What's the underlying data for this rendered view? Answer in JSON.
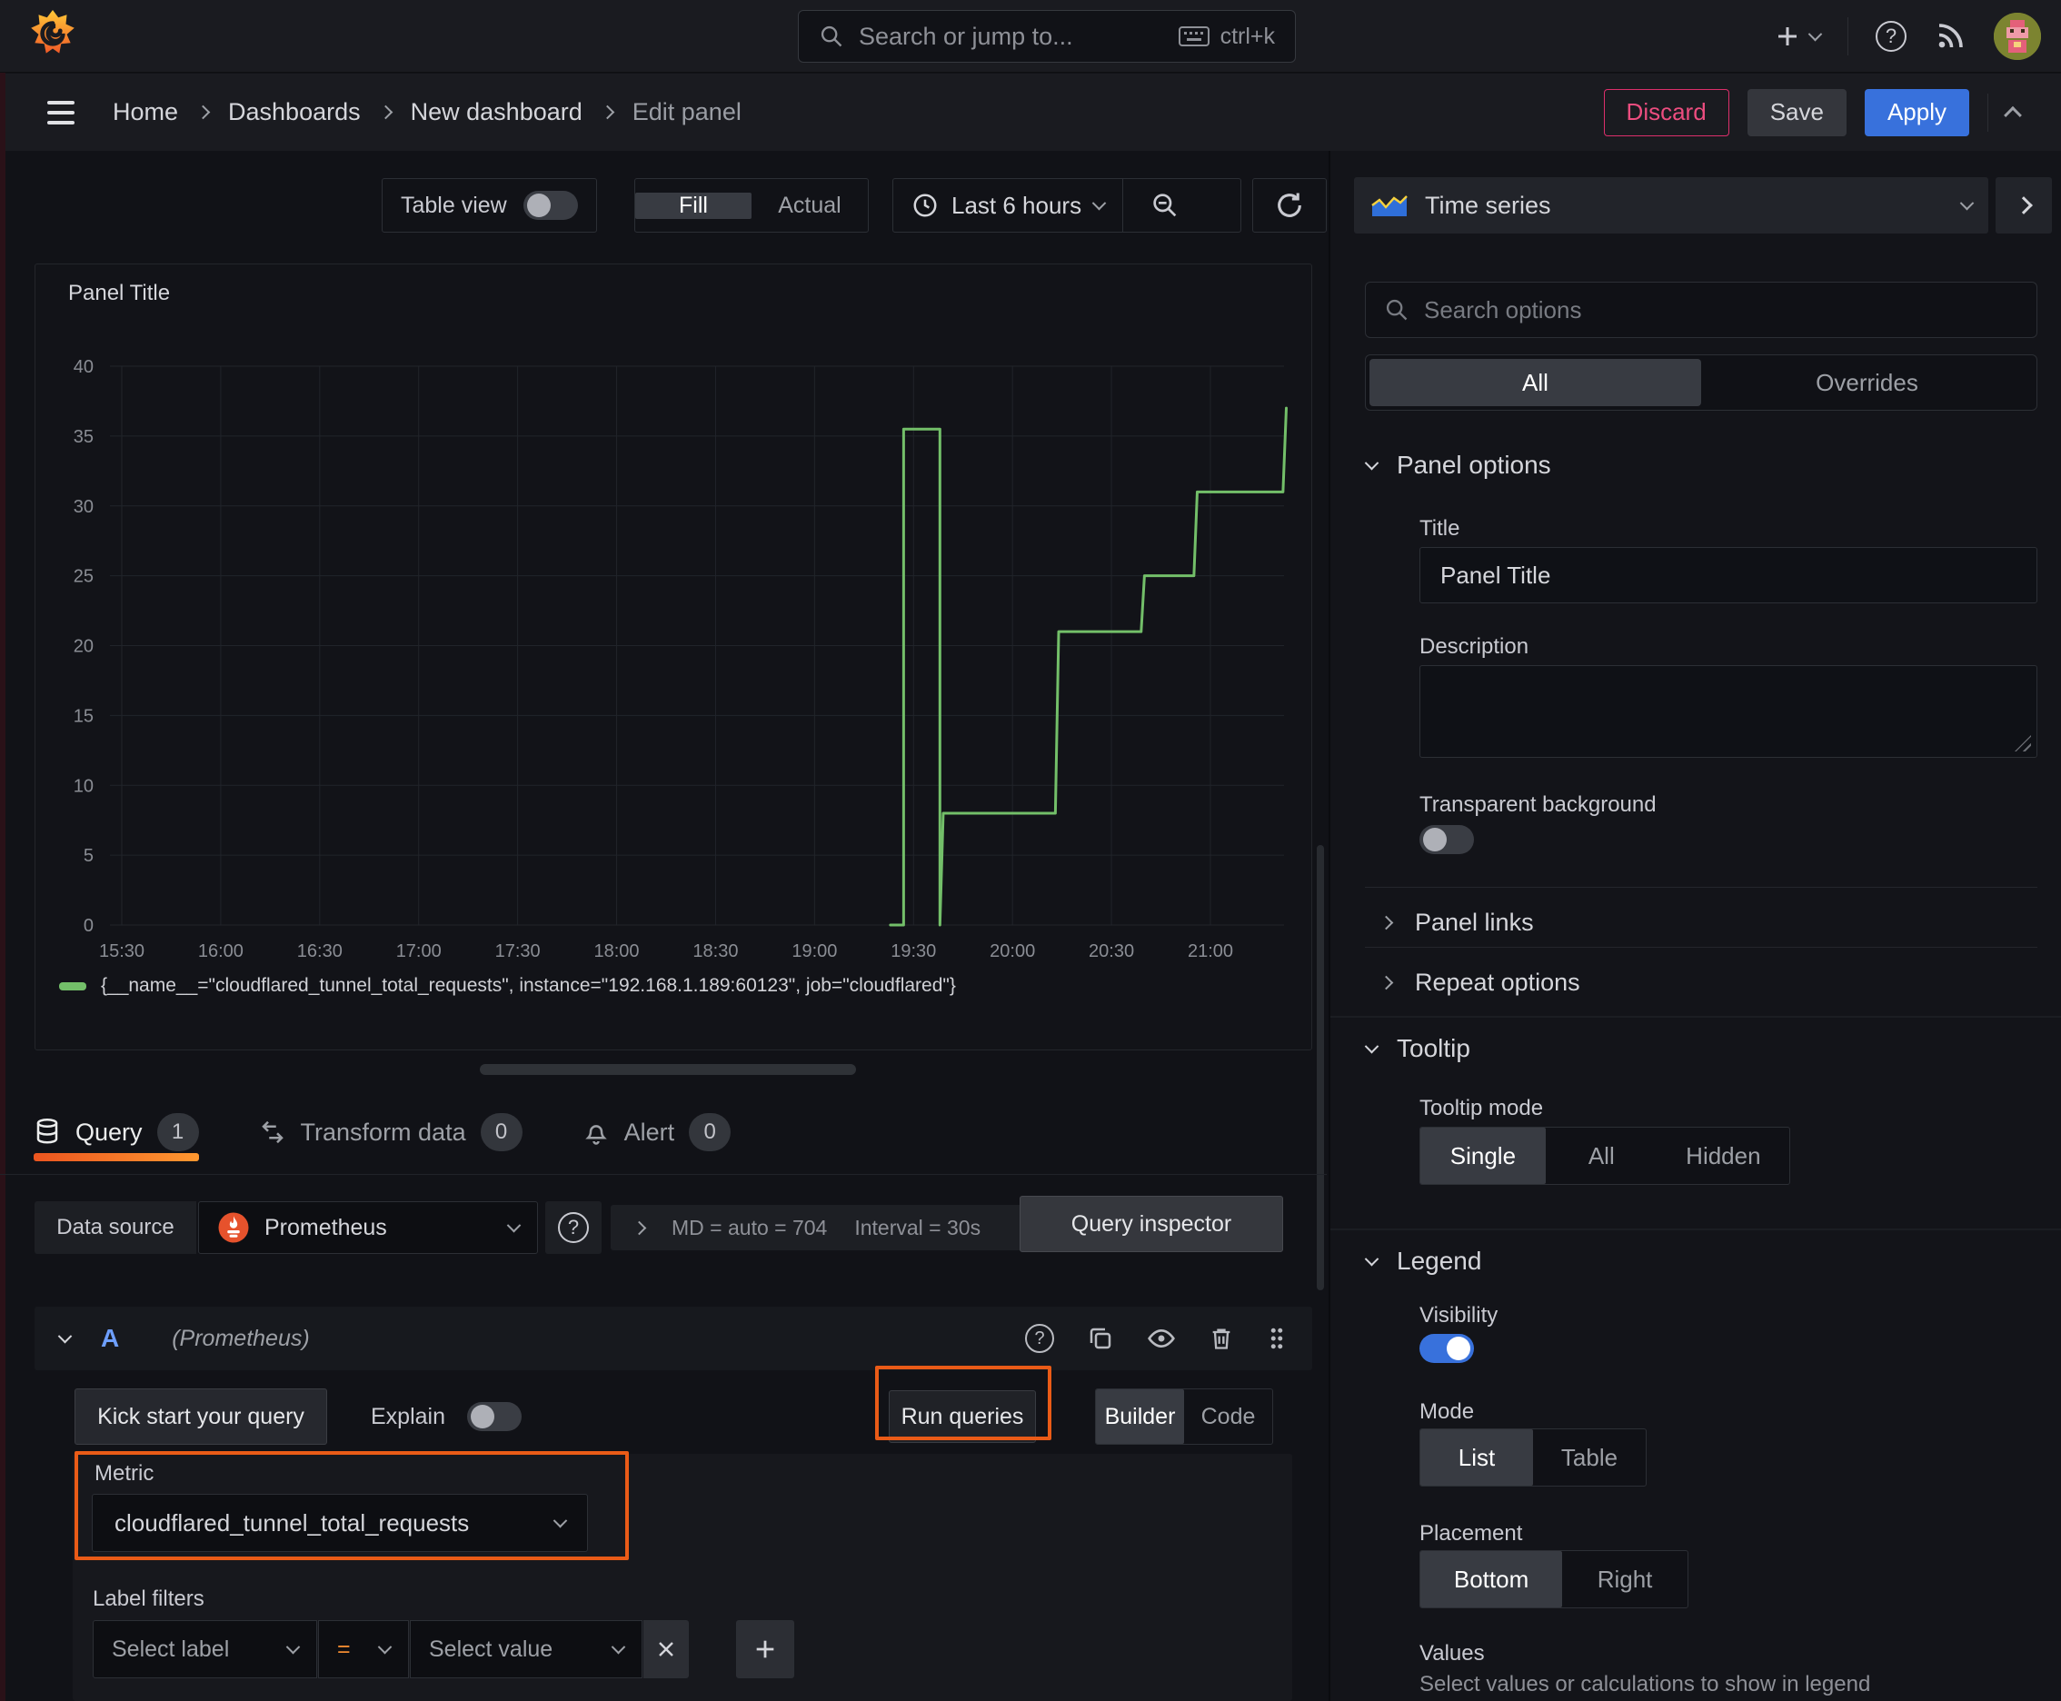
{
  "colors": {
    "accent_orange": "#ea5b17",
    "series_green": "#73bf69",
    "primary_blue": "#3871dc",
    "danger_pink": "#dc2f6b",
    "tab_underline": "#ff9830"
  },
  "topbar": {
    "search_placeholder": "Search or jump to...",
    "shortcut": "ctrl+k"
  },
  "breadcrumb": {
    "items": [
      "Home",
      "Dashboards",
      "New dashboard",
      "Edit panel"
    ]
  },
  "actions": {
    "discard": "Discard",
    "save": "Save",
    "apply": "Apply"
  },
  "toolbar": {
    "table_view": "Table view",
    "fill": "Fill",
    "actual": "Actual",
    "time_range": "Last 6 hours"
  },
  "panel": {
    "title": "Panel Title"
  },
  "chart_data": {
    "type": "line",
    "title": "Panel Title",
    "x_ticks": [
      "15:30",
      "16:00",
      "16:30",
      "17:00",
      "17:30",
      "18:00",
      "18:30",
      "19:00",
      "19:30",
      "20:00",
      "20:30",
      "21:00"
    ],
    "y_ticks": [
      0,
      5,
      10,
      15,
      20,
      25,
      30,
      35,
      40
    ],
    "ylim": [
      0,
      42
    ],
    "grid": true,
    "legend_position": "bottom",
    "series": [
      {
        "name": "{__name__=\"cloudflared_tunnel_total_requests\", instance=\"192.168.1.189:60123\", job=\"cloudflared\"}",
        "color": "#73bf69",
        "points": [
          [
            "19:23",
            0
          ],
          [
            "19:27",
            0
          ],
          [
            "19:27",
            35.5
          ],
          [
            "19:38",
            35.5
          ],
          [
            "19:38",
            0
          ],
          [
            "19:39",
            8
          ],
          [
            "20:13",
            8
          ],
          [
            "20:14",
            21
          ],
          [
            "20:39",
            21
          ],
          [
            "20:40",
            25
          ],
          [
            "20:55",
            25
          ],
          [
            "20:56",
            31
          ],
          [
            "21:22",
            31
          ],
          [
            "21:23",
            37
          ]
        ]
      }
    ]
  },
  "query_tabs": {
    "query": "Query",
    "query_count": "1",
    "transform": "Transform data",
    "transform_count": "0",
    "alert": "Alert",
    "alert_count": "0"
  },
  "datasource": {
    "label": "Data source",
    "name": "Prometheus",
    "stats_md": "MD = auto = 704",
    "stats_interval": "Interval = 30s",
    "inspector": "Query inspector"
  },
  "query_row": {
    "ref_id": "A",
    "ds_hint": "(Prometheus)"
  },
  "query_editor": {
    "kick_start": "Kick start your query",
    "explain": "Explain",
    "run_queries": "Run queries",
    "builder": "Builder",
    "code": "Code",
    "metric_label": "Metric",
    "metric_value": "cloudflared_tunnel_total_requests",
    "label_filters": "Label filters",
    "select_label": "Select label",
    "operator": "=",
    "select_value": "Select value"
  },
  "options": {
    "viz_type": "Time series",
    "search_placeholder": "Search options",
    "tab_all": "All",
    "tab_overrides": "Overrides",
    "panel_options": "Panel options",
    "title_label": "Title",
    "title_value": "Panel Title",
    "description_label": "Description",
    "transparent_bg": "Transparent background",
    "panel_links": "Panel links",
    "repeat_options": "Repeat options",
    "tooltip": "Tooltip",
    "tooltip_mode": "Tooltip mode",
    "tooltip_modes": [
      "Single",
      "All",
      "Hidden"
    ],
    "legend": "Legend",
    "visibility": "Visibility",
    "mode": "Mode",
    "modes": [
      "List",
      "Table"
    ],
    "placement": "Placement",
    "placements": [
      "Bottom",
      "Right"
    ],
    "values_label": "Values",
    "values_hint": "Select values or calculations to show in legend"
  }
}
